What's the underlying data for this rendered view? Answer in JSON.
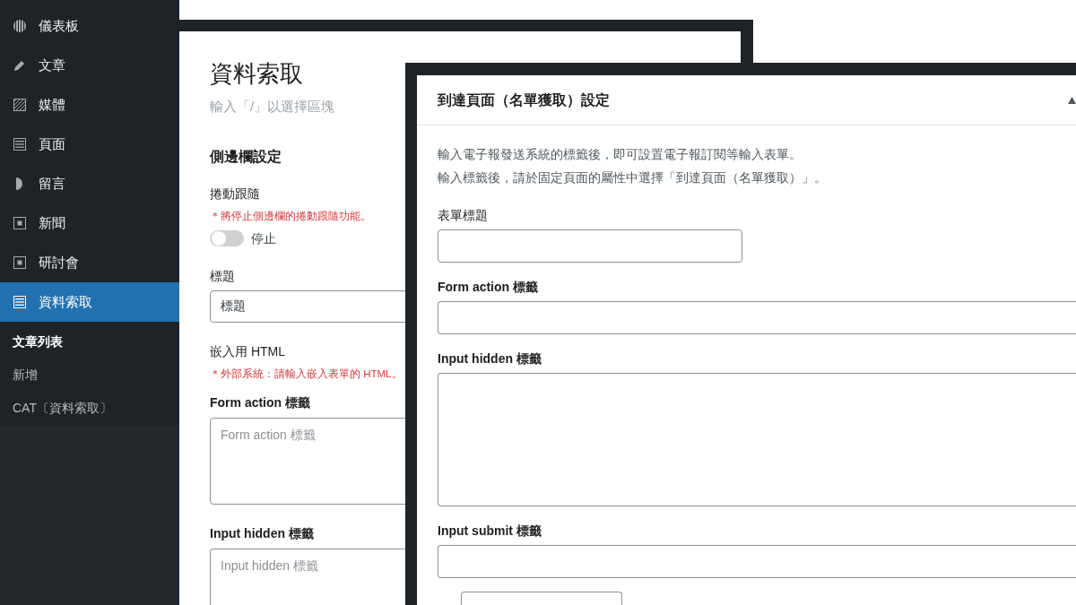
{
  "sidebar": {
    "items": [
      {
        "label": "儀表板",
        "selected": false
      },
      {
        "label": "文章",
        "selected": false
      },
      {
        "label": "媒體",
        "selected": false
      },
      {
        "label": "頁面",
        "selected": false
      },
      {
        "label": "留言",
        "selected": false
      },
      {
        "label": "新聞",
        "selected": false
      },
      {
        "label": "研討會",
        "selected": false
      },
      {
        "label": "資料索取",
        "selected": true
      }
    ],
    "submenu": [
      {
        "label": "文章列表",
        "selected": true
      },
      {
        "label": "新增",
        "selected": false
      },
      {
        "label": "CAT〔資料索取〕",
        "selected": false
      }
    ]
  },
  "editor": {
    "title": "資料索取",
    "placeholder": "輸入「/」以選擇區塊",
    "section_title": "側邊欄設定",
    "fields": [
      {
        "kind": "toggle",
        "label": "捲動跟隨",
        "label_bold": false,
        "note": "＊將停止側邊欄的捲動跟隨功能。",
        "on": false,
        "state_label": "停止"
      },
      {
        "kind": "text",
        "label": "標題",
        "label_bold": false,
        "value": "標題"
      },
      {
        "kind": "heading",
        "label": "嵌入用 HTML",
        "label_bold": false,
        "note": "＊外部系統：請輸入嵌入表單的 HTML。"
      },
      {
        "kind": "textarea",
        "label": "Form action 標籤",
        "label_bold": true,
        "placeholder": "Form action 標籤"
      },
      {
        "kind": "textarea",
        "label": "Input hidden 標籤",
        "label_bold": true,
        "placeholder": "Input hidden 標籤"
      }
    ]
  },
  "dialog": {
    "title": "到達頁面（名單獲取）設定",
    "expanded": true,
    "description": [
      "輸入電子報發送系統的標籤後，即可設置電子報訂閱等輸入表單。",
      "輸入標籤後，請於固定頁面的屬性中選擇「到達頁面（名單獲取）」。"
    ],
    "fields": [
      {
        "kind": "short",
        "label": "表單標題",
        "label_bold": false
      },
      {
        "kind": "text",
        "label": "Form action 標籤",
        "label_bold": true
      },
      {
        "kind": "textarea",
        "label": "Input hidden 標籤",
        "label_bold": true
      },
      {
        "kind": "text",
        "label": "Input submit 標籤",
        "label_bold": true
      },
      {
        "kind": "item"
      }
    ]
  }
}
